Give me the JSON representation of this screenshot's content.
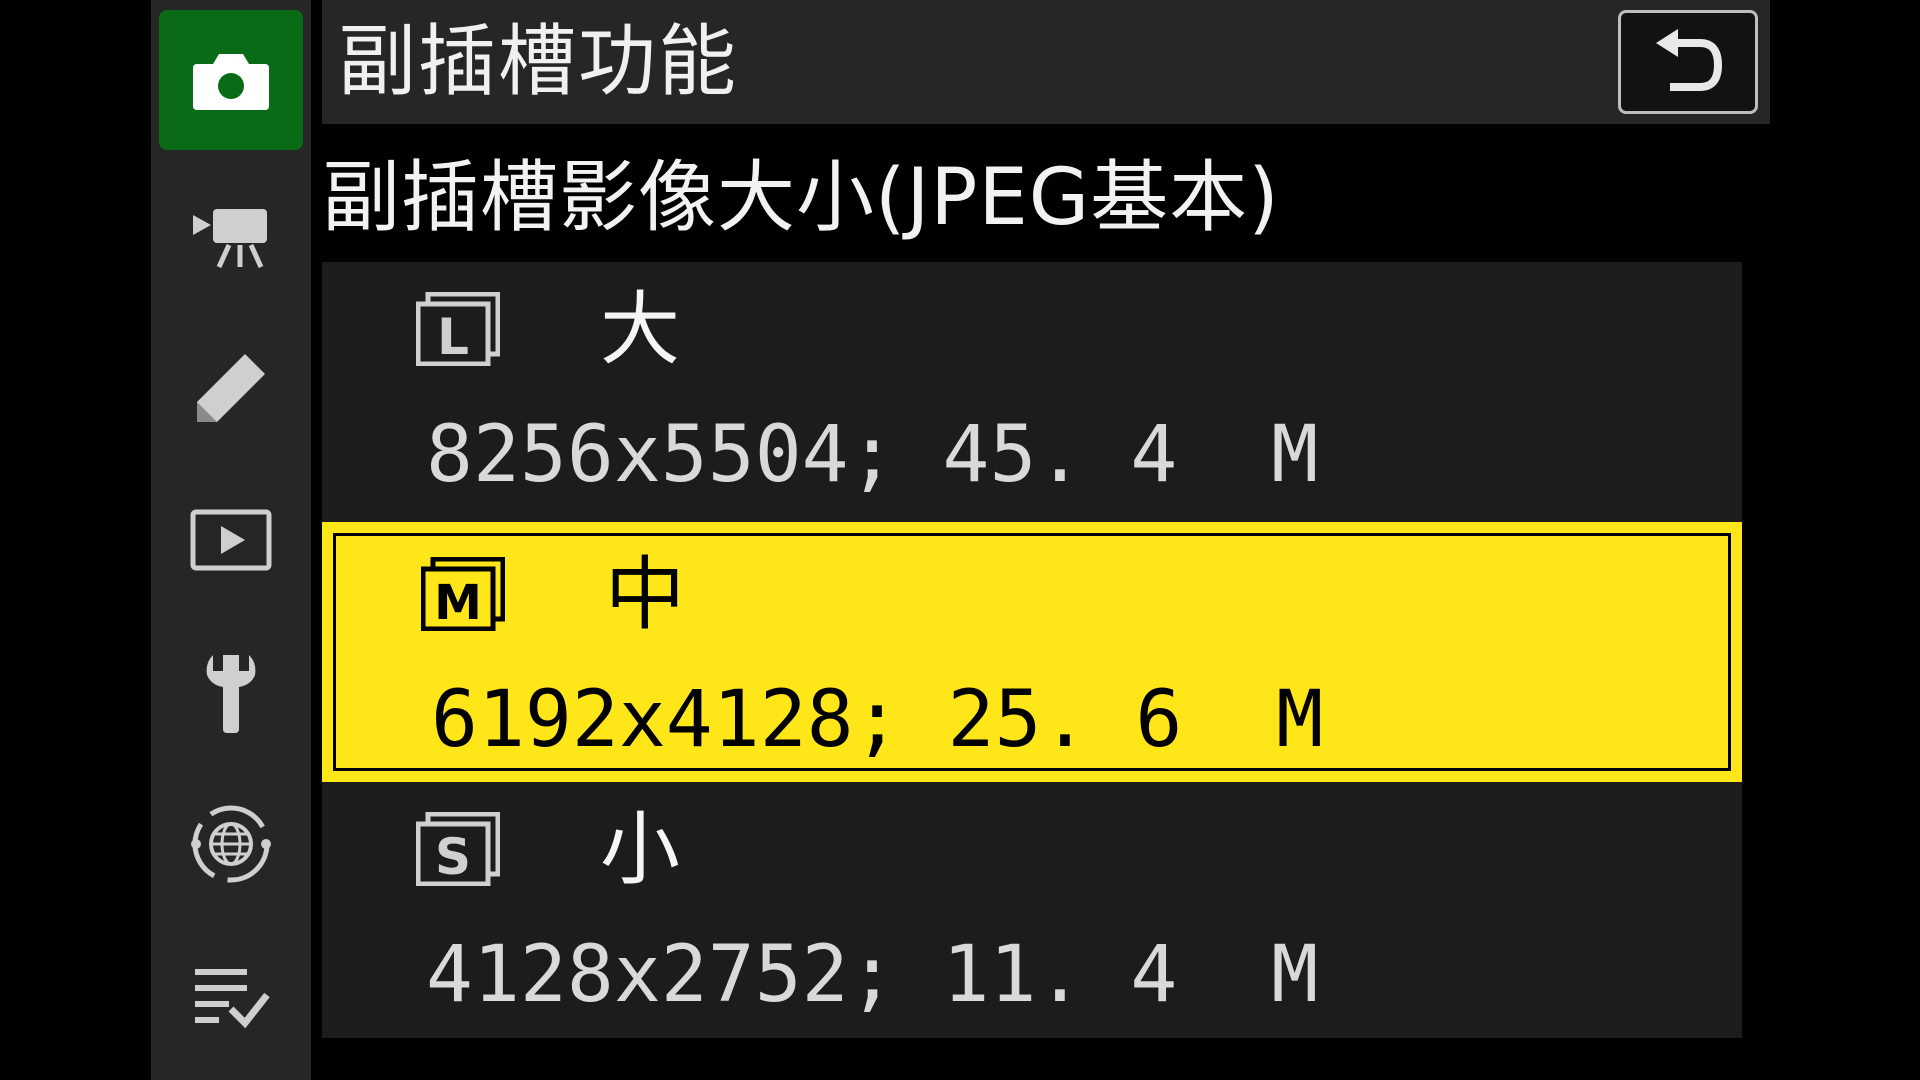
{
  "header": {
    "title": "副插槽功能",
    "back_icon": "return-arrow-icon"
  },
  "subtitle": "副插槽影像大小(JPEG基本)",
  "sidebar": {
    "items": [
      {
        "icon": "camera-icon",
        "active": true
      },
      {
        "icon": "movie-camera-icon",
        "active": false
      },
      {
        "icon": "pencil-icon",
        "active": false
      },
      {
        "icon": "playback-icon",
        "active": false
      },
      {
        "icon": "wrench-icon",
        "active": false
      },
      {
        "icon": "network-globe-icon",
        "active": false
      },
      {
        "icon": "my-menu-icon",
        "active": false
      }
    ]
  },
  "options": [
    {
      "badge": "L",
      "label": "大",
      "detail": "8256x5504; 45. 4  M",
      "selected": false
    },
    {
      "badge": "M",
      "label": "中",
      "detail": "6192x4128; 25. 6  M",
      "selected": true
    },
    {
      "badge": "S",
      "label": "小",
      "detail": "4128x2752; 11. 4  M",
      "selected": false
    }
  ],
  "colors": {
    "accent_active": "#0a6b17",
    "selection": "#ffe619",
    "background": "#000000",
    "panel": "#262626"
  }
}
